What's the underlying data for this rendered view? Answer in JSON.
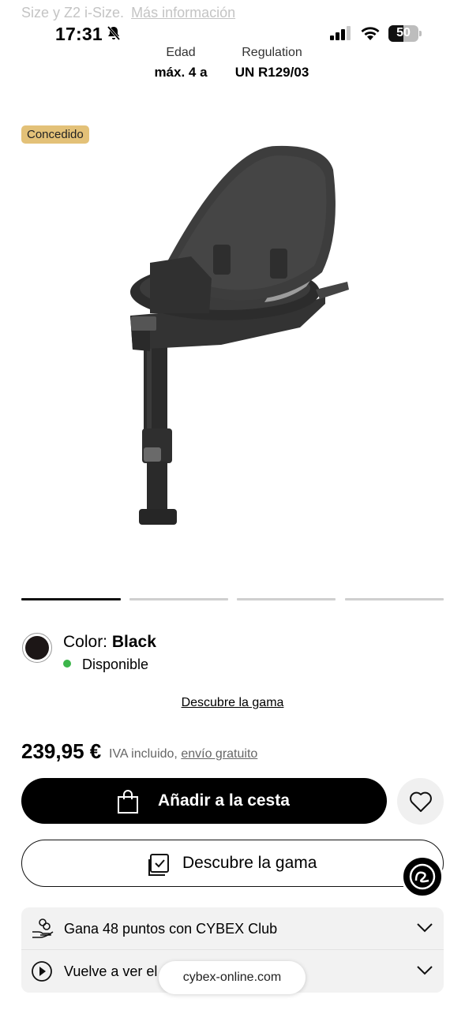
{
  "top_fade": {
    "text": "Size y Z2 i-Size.",
    "link": "Más información"
  },
  "status_bar": {
    "time": "17:31",
    "battery": "50",
    "battery_level": 0.5,
    "icons": [
      "bell-slash-icon",
      "signal-icon",
      "wifi-icon",
      "battery-icon"
    ]
  },
  "specs": [
    {
      "label": "Edad",
      "value": "máx. 4 a"
    },
    {
      "label": "Regulation",
      "value": "UN R129/03"
    }
  ],
  "badge": "Concedido",
  "gallery": {
    "slides": 4,
    "active_index": 0
  },
  "color": {
    "prefix": "Color:",
    "name": "Black",
    "swatch": "#1c1616"
  },
  "availability": {
    "text": "Disponible",
    "color": "#3cb54a"
  },
  "range_link": "Descubre la gama",
  "price": {
    "amount": "239,95 €",
    "vat": "IVA incluido,",
    "shipping": "envío gratuito"
  },
  "actions": {
    "add_to_cart": "Añadir a la cesta",
    "discover_range": "Descubre la gama"
  },
  "panel": {
    "club": "Gana 48 puntos con CYBEX Club",
    "replay": "Vuelve a ver el"
  },
  "url": "cybex-online.com"
}
